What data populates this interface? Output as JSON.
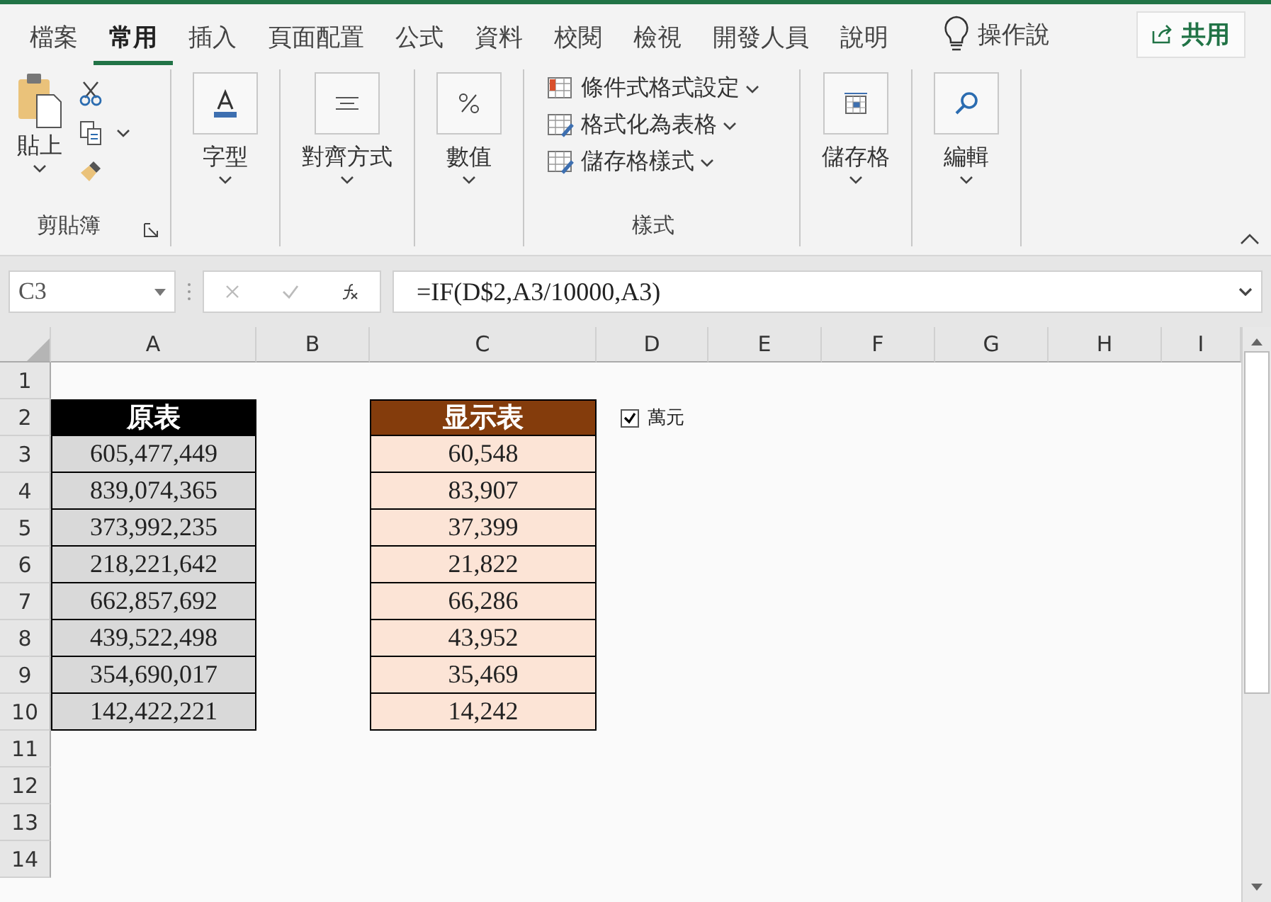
{
  "menu_tabs": [
    {
      "label": "檔案",
      "selected": false
    },
    {
      "label": "常用",
      "selected": true
    },
    {
      "label": "插入",
      "selected": false
    },
    {
      "label": "頁面配置",
      "selected": false
    },
    {
      "label": "公式",
      "selected": false
    },
    {
      "label": "資料",
      "selected": false
    },
    {
      "label": "校閱",
      "selected": false
    },
    {
      "label": "檢視",
      "selected": false
    },
    {
      "label": "開發人員",
      "selected": false
    },
    {
      "label": "說明",
      "selected": false
    }
  ],
  "tell_me": "操作說",
  "share_button": "共用",
  "ribbon_groups": [
    {
      "kind": "clipboard",
      "button": "貼上",
      "label": "剪貼簿"
    },
    {
      "kind": "font",
      "button": "字型"
    },
    {
      "kind": "alignment",
      "button": "對齊方式"
    },
    {
      "kind": "number",
      "button": "數值"
    },
    {
      "kind": "styles",
      "items": [
        "條件式格式設定",
        "格式化為表格",
        "儲存格樣式"
      ],
      "label": "樣式"
    },
    {
      "kind": "cells",
      "button": "儲存格"
    },
    {
      "kind": "editing",
      "button": "編輯"
    }
  ],
  "formula_bar": {
    "name_box": "C3",
    "formula": "=IF(D$2,A3/10000,A3)"
  },
  "columns": [
    "A",
    "B",
    "C",
    "D",
    "E",
    "F",
    "G",
    "H",
    "I"
  ],
  "row_numbers": [
    "1",
    "2",
    "3",
    "4",
    "5",
    "6",
    "7",
    "8",
    "9",
    "10",
    "11",
    "12",
    "13",
    "14"
  ],
  "original_table": {
    "header": "原表",
    "values": [
      "605,477,449",
      "839,074,365",
      "373,992,235",
      "218,221,642",
      "662,857,692",
      "439,522,498",
      "354,690,017",
      "142,422,221"
    ]
  },
  "display_table": {
    "header": "显示表",
    "values": [
      "60,548",
      "83,907",
      "37,399",
      "21,822",
      "66,286",
      "43,952",
      "35,469",
      "14,242"
    ]
  },
  "checkbox": {
    "label": "萬元",
    "checked": true
  }
}
